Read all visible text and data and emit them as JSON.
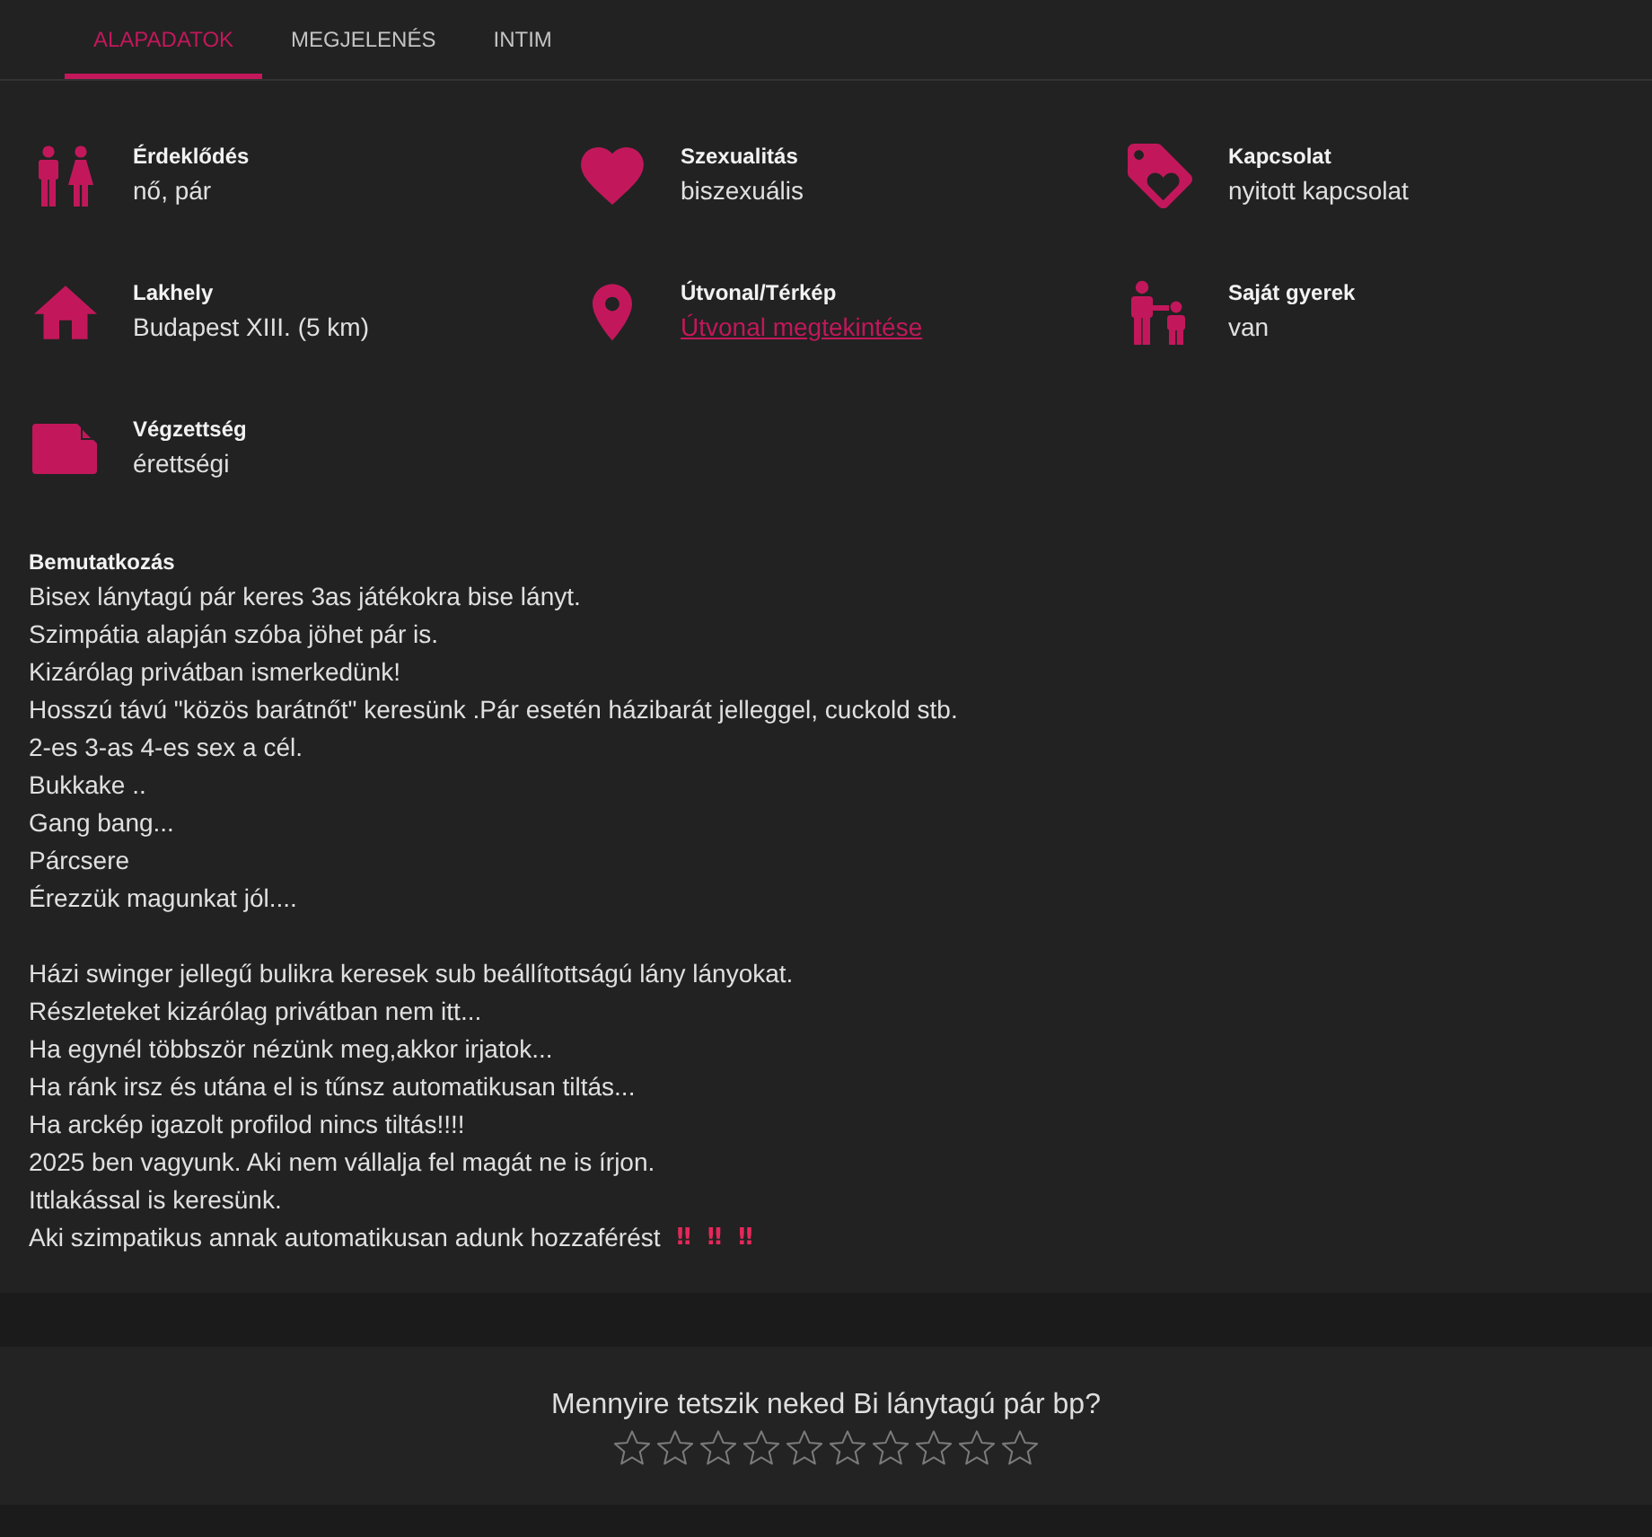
{
  "tabs": [
    {
      "label": "ALAPADATOK",
      "selected": true
    },
    {
      "label": "MEGJELENÉS",
      "selected": false
    },
    {
      "label": "INTIM",
      "selected": false
    }
  ],
  "details": [
    {
      "kind": "text",
      "label": "Érdeklődés",
      "value": "nő, pár"
    },
    {
      "kind": "text",
      "label": "Szexualitás",
      "value": "biszexuális"
    },
    {
      "kind": "text",
      "label": "Kapcsolat",
      "value": "nyitott kapcsolat"
    },
    {
      "kind": "text",
      "label": "Lakhely",
      "value": "Budapest XIII. (5 km)"
    },
    {
      "kind": "link",
      "label": "Útvonal/Térkép",
      "value": "Útvonal megtekintése"
    },
    {
      "kind": "text",
      "label": "Saját gyerek",
      "value": "van"
    },
    {
      "kind": "text",
      "label": "Végzettség",
      "value": "érettségi"
    }
  ],
  "introduction": {
    "title": "Bemutatkozás",
    "paragraphs": [
      {
        "lines": [
          {
            "text": "Bisex lánytagú pár keres 3as játékokra bise lányt."
          },
          {
            "text": "Szimpátia alapján szóba jöhet pár is."
          },
          {
            "text": "Kizárólag privátban ismerkedünk!"
          },
          {
            "text": "Hosszú távú \"közös barátnőt\" keresünk .Pár esetén házibarát jelleggel, cuckold stb."
          },
          {
            "text": "2-es 3-as 4-es sex a cél."
          },
          {
            "text": "Bukkake .."
          },
          {
            "text": "Gang bang..."
          },
          {
            "text": "Párcsere"
          },
          {
            "text": "Érezzük magunkat jól...."
          }
        ]
      },
      {
        "lines": [
          {
            "text": "Házi swinger jellegű bulikra keresek sub beállítottságú lány lányokat."
          },
          {
            "text": "Részleteket kizárólag privátban nem itt..."
          },
          {
            "text": "Ha egynél többször nézünk meg,akkor irjatok..."
          },
          {
            "text": "Ha ránk irsz és utána el is tűnsz automatikusan tiltás..."
          },
          {
            "text": "Ha arckép igazolt profilod nincs tiltás!!!!"
          },
          {
            "text": "2025 ben vagyunk. Aki nem vállalja fel magát ne is írjon."
          },
          {
            "text": "Ittlakással is keresünk."
          },
          {
            "text": "Aki szimpatikus annak automatikusan adunk hozzaférést",
            "emojis": [
              "‼",
              "‼",
              "‼"
            ]
          }
        ]
      }
    ]
  },
  "rating": {
    "question": "Mennyire tetszik neked Bi lánytagú pár bp?",
    "stars": 0
  }
}
